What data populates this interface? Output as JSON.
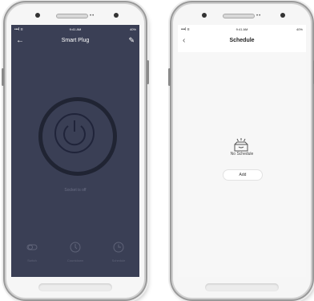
{
  "left_phone": {
    "status": {
      "signal": "•••l ≡",
      "time": "9:41 AM",
      "battery": "40%"
    },
    "nav": {
      "back": "←",
      "title": "Smart Plug",
      "edit": "✎"
    },
    "socket_status": "Socket is off",
    "bottom": [
      {
        "label": "Switch",
        "icon": "switch-icon"
      },
      {
        "label": "Countdown",
        "icon": "countdown-icon"
      },
      {
        "label": "Schedule",
        "icon": "schedule-icon"
      }
    ]
  },
  "right_phone": {
    "status": {
      "signal": "•••l ≡",
      "time": "9:41 AM",
      "battery": "40%"
    },
    "nav": {
      "back": "‹",
      "title": "Schedule"
    },
    "empty_text": "No Schedule",
    "add_label": "Add",
    "icon": "empty-box-icon"
  },
  "colors": {
    "dark_bg": "#3a3f55",
    "ring": "#202433",
    "light_bg": "#f7f7f7"
  }
}
